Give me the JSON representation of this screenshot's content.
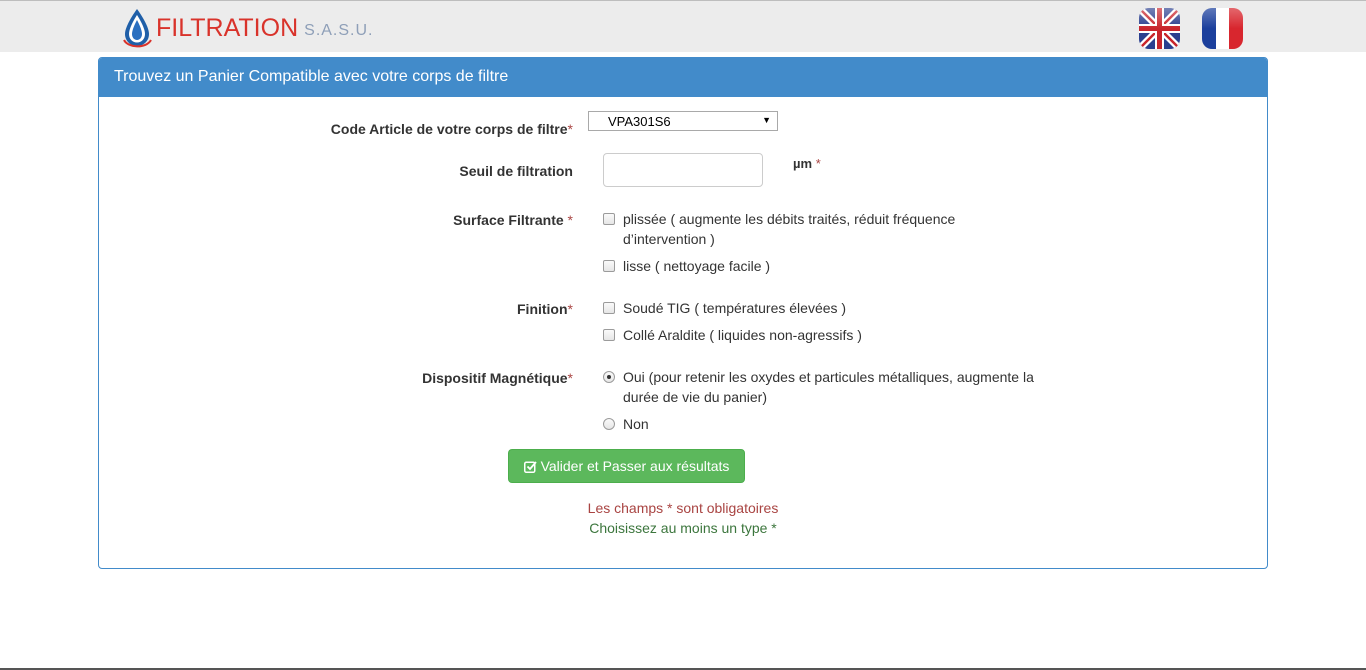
{
  "header": {
    "brand": "FILTRATION",
    "brand_suffix": "S.A.S.U.",
    "languages": [
      {
        "name": "english-flag"
      },
      {
        "name": "french-flag"
      }
    ]
  },
  "panel": {
    "title": "Trouvez un Panier Compatible avec votre corps de filtre"
  },
  "form": {
    "code_label": "Code Article de votre corps de filtre",
    "code_value": "VPA301S6",
    "seuil_label": "Seuil de filtration",
    "seuil_value": "",
    "seuil_unit": "µm",
    "surface_label": "Surface Filtrante",
    "surface_options": [
      {
        "line1": "plissée ( augmente les débits traités, réduit fréquence",
        "line2": "d’intervention )",
        "checked": false
      },
      {
        "line1": "lisse ( nettoyage facile )",
        "line2": "",
        "checked": false
      }
    ],
    "finition_label": "Finition",
    "finition_options": [
      {
        "label": "Soudé TIG ( températures élevées )",
        "checked": false
      },
      {
        "label": "Collé Araldite ( liquides non-agressifs )",
        "checked": false
      }
    ],
    "magnetic_label": "Dispositif Magnétique",
    "magnetic_options": [
      {
        "line1": "Oui (pour retenir les oxydes et particules métalliques, augmente la",
        "line2": "durée de vie du panier)",
        "selected": true
      },
      {
        "line1": "Non",
        "line2": "",
        "selected": false
      }
    ],
    "required_mark": "*",
    "submit_label": "Valider et Passer aux résultats",
    "note_required": "Les champs * sont obligatoires",
    "note_type": "Choisissez au moins un type *"
  },
  "colors": {
    "primary": "#428bca",
    "success": "#5cb85c",
    "danger": "#a94442",
    "success_text": "#3c763d",
    "brand_red": "#d9332b"
  }
}
